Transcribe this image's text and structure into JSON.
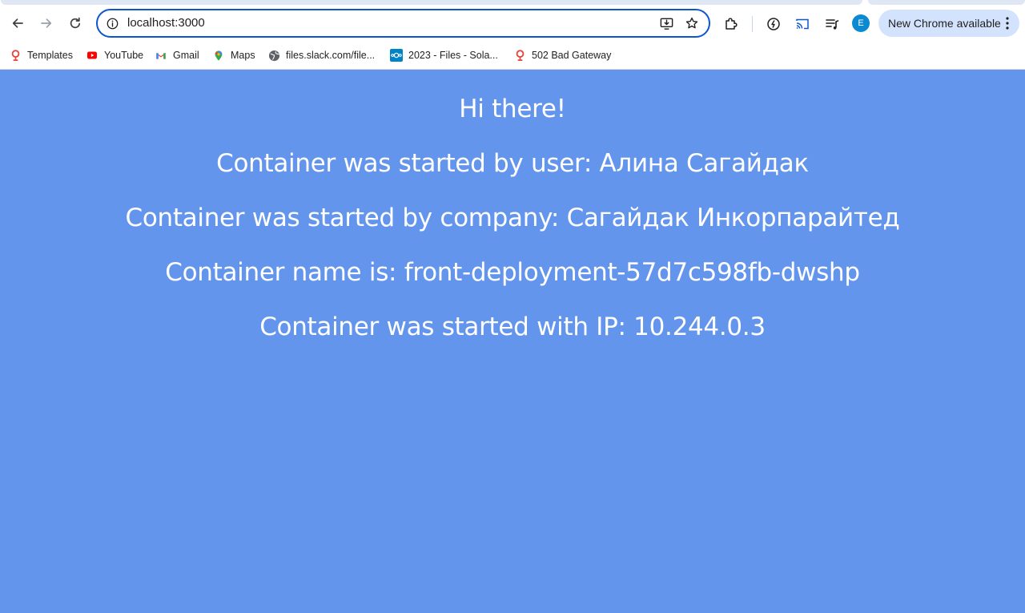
{
  "browser": {
    "url": "localhost:3000",
    "update_label": "New Chrome available",
    "profile_initial": "E",
    "bookmarks": [
      {
        "label": "Templates",
        "icon": "pin-icon"
      },
      {
        "label": "YouTube",
        "icon": "youtube-icon"
      },
      {
        "label": "Gmail",
        "icon": "gmail-icon"
      },
      {
        "label": "Maps",
        "icon": "maps-icon"
      },
      {
        "label": "files.slack.com/file...",
        "icon": "globe-icon"
      },
      {
        "label": "2023 - Files - Sola...",
        "icon": "nextcloud-icon"
      },
      {
        "label": "502 Bad Gateway",
        "icon": "pin-icon"
      }
    ],
    "accent_color": "#0b57d0"
  },
  "page": {
    "background": "#6495ed",
    "greeting": "Hi there!",
    "user_line": "Container was started by user: Алина Сагайдак",
    "company_line": "Container was started by company: Сагайдак Инкорпарайтед",
    "name_line": "Container name is: front-deployment-57d7c598fb-dwshp",
    "ip_line": "Container was started with IP: 10.244.0.3"
  }
}
